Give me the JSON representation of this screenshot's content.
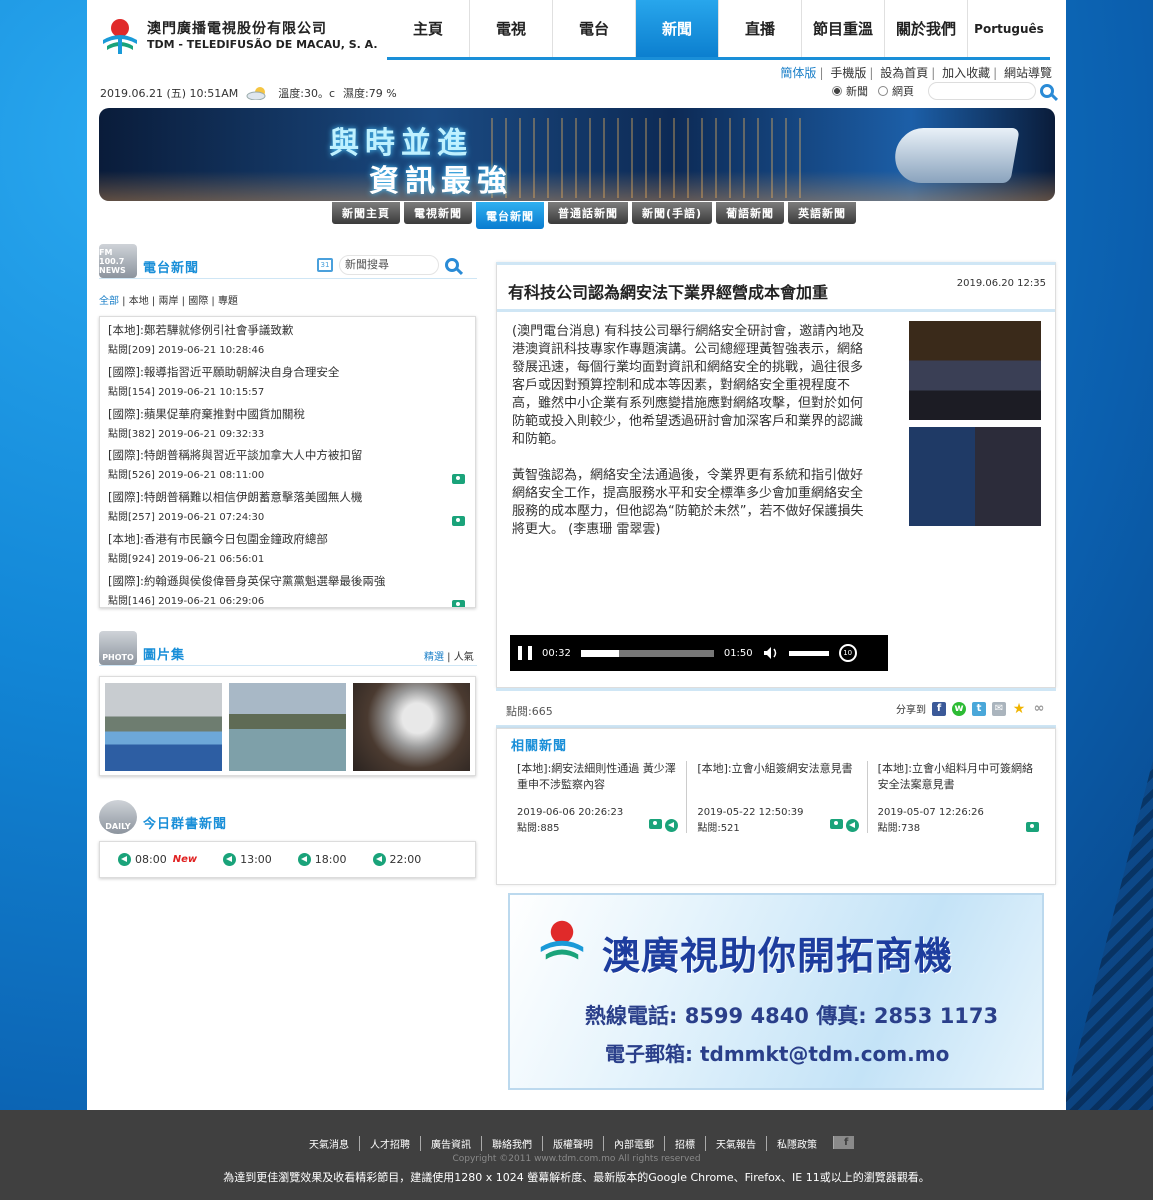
{
  "logo": {
    "cn": "澳門廣播電視股份有限公司",
    "en": "TDM - TELEDIFUSÃO DE MACAU, S. A."
  },
  "nav": [
    "主頁",
    "電視",
    "電台",
    "新聞",
    "直播",
    "節目重溫",
    "關於我們",
    "Português"
  ],
  "nav_active": 3,
  "toplinks": [
    "簡体版",
    "手機版",
    "設為首頁",
    "加入收藏",
    "網站導覽"
  ],
  "weather": {
    "date": "2019.06.21 (五) 10:51AM",
    "temp": "溫度:30。c",
    "humidity": "濕度:79 %"
  },
  "search_top": {
    "opt1": "新聞",
    "opt2": "網頁"
  },
  "banner": {
    "line1": "與時並進",
    "line2": "資訊最強"
  },
  "subnav": [
    "新聞主頁",
    "電視新聞",
    "電台新聞",
    "普通話新聞",
    "新聞(手語)",
    "葡語新聞",
    "英語新聞"
  ],
  "subnav_active": 2,
  "radio": {
    "icon": "FM 100.7 NEWS",
    "title": "電台新聞",
    "search_placeholder": "新聞搜尋",
    "filters": [
      "全部",
      "本地",
      "兩岸",
      "國際",
      "專題"
    ],
    "items": [
      {
        "h": "[本地]:鄭若驊就修例引社會爭議致歉",
        "m": "點閱[209] 2019-06-21 10:28:46",
        "cam": false
      },
      {
        "h": "[國際]:報導指習近平願助朝解決自身合理安全",
        "m": "點閱[154] 2019-06-21 10:15:57",
        "cam": false
      },
      {
        "h": "[國際]:蘋果促華府棄推對中國貨加關稅",
        "m": "點閱[382] 2019-06-21 09:32:33",
        "cam": false
      },
      {
        "h": "[國際]:特朗普稱將與習近平談加拿大人中方被扣留",
        "m": "點閱[526] 2019-06-21 08:11:00",
        "cam": true
      },
      {
        "h": "[國際]:特朗普稱難以相信伊朗蓄意擊落美國無人機",
        "m": "點閱[257] 2019-06-21 07:24:30",
        "cam": true
      },
      {
        "h": "[本地]:香港有市民籲今日包圍金鐘政府總部",
        "m": "點閱[924] 2019-06-21 06:56:01",
        "cam": false
      },
      {
        "h": "[國際]:約翰遜與侯俊偉晉身英保守黨黨魁選舉最後兩強",
        "m": "點閱[146] 2019-06-21 06:29:06",
        "cam": true
      }
    ]
  },
  "photo": {
    "icon": "PHOTO",
    "title": "圖片集",
    "links": [
      "精選",
      "人氣"
    ]
  },
  "daily": {
    "icon": "DAILY",
    "title": "今日群書新聞",
    "times": [
      "08:00",
      "13:00",
      "18:00",
      "22:00"
    ],
    "new_label": "New"
  },
  "article": {
    "title": "有科技公司認為網安法下業界經營成本會加重",
    "time": "2019.06.20 12:35",
    "p1": "(澳門電台消息) 有科技公司舉行網絡安全研討會，邀請內地及港澳資訊科技專家作專題演講。公司總經理黃智強表示，網絡發展迅速，每個行業均面對資訊和網絡安全的挑戰，過往很多客戶或因對預算控制和成本等因素，對網絡安全重視程度不高，雖然中小企業有系列應變措施應對網絡攻擊，但對於如何防範或投入則較少，他希望透過研討會加深客戶和業界的認識和防範。",
    "p2": "黃智強認為，網絡安全法通過後，令業界更有系統和指引做好網絡安全工作，提高服務水平和安全標準多少會加重網絡安全服務的成本壓力，但他認為“防範於未然”，若不做好保護損失將更大。 (李惠珊  雷翠雲)",
    "player": {
      "current": "00:32",
      "duration": "01:50",
      "progress": 0.29,
      "rewind": "10"
    },
    "hits": "點閱:665",
    "share": "分享到"
  },
  "related": {
    "title": "相關新聞",
    "items": [
      {
        "h": "[本地]:網安法細則性通過 黃少澤重申不涉監察內容",
        "d": "2019-06-06 20:26:23",
        "k": "點閱:885",
        "audio": true
      },
      {
        "h": "[本地]:立會小組簽網安法意見書",
        "d": "2019-05-22 12:50:39",
        "k": "點閱:521",
        "audio": true
      },
      {
        "h": "[本地]:立會小組料月中可簽網絡安全法案意見書",
        "d": "2019-05-07 12:26:26",
        "k": "點閱:738",
        "audio": false
      }
    ]
  },
  "ad": {
    "h1": "澳廣視助你開拓商機",
    "h2": "熱線電話: 8599 4840  傳真: 2853 1173",
    "h3": "電子郵箱: tdmmkt@tdm.com.mo"
  },
  "footer": {
    "links": [
      "天氣消息",
      "人才招聘",
      "廣告資訊",
      "聯絡我們",
      "版權聲明",
      "內部電郵",
      "招標",
      "天氣報告",
      "私隱政策"
    ],
    "copy": "Copyright ©2011 www.tdm.com.mo All rights reserved",
    "note": "為達到更佳瀏覽效果及收看精彩節目，建議使用1280 x 1024 螢幕解析度、最新版本的Google Chrome、Firefox、IE 11或以上的瀏覽器觀看。"
  }
}
